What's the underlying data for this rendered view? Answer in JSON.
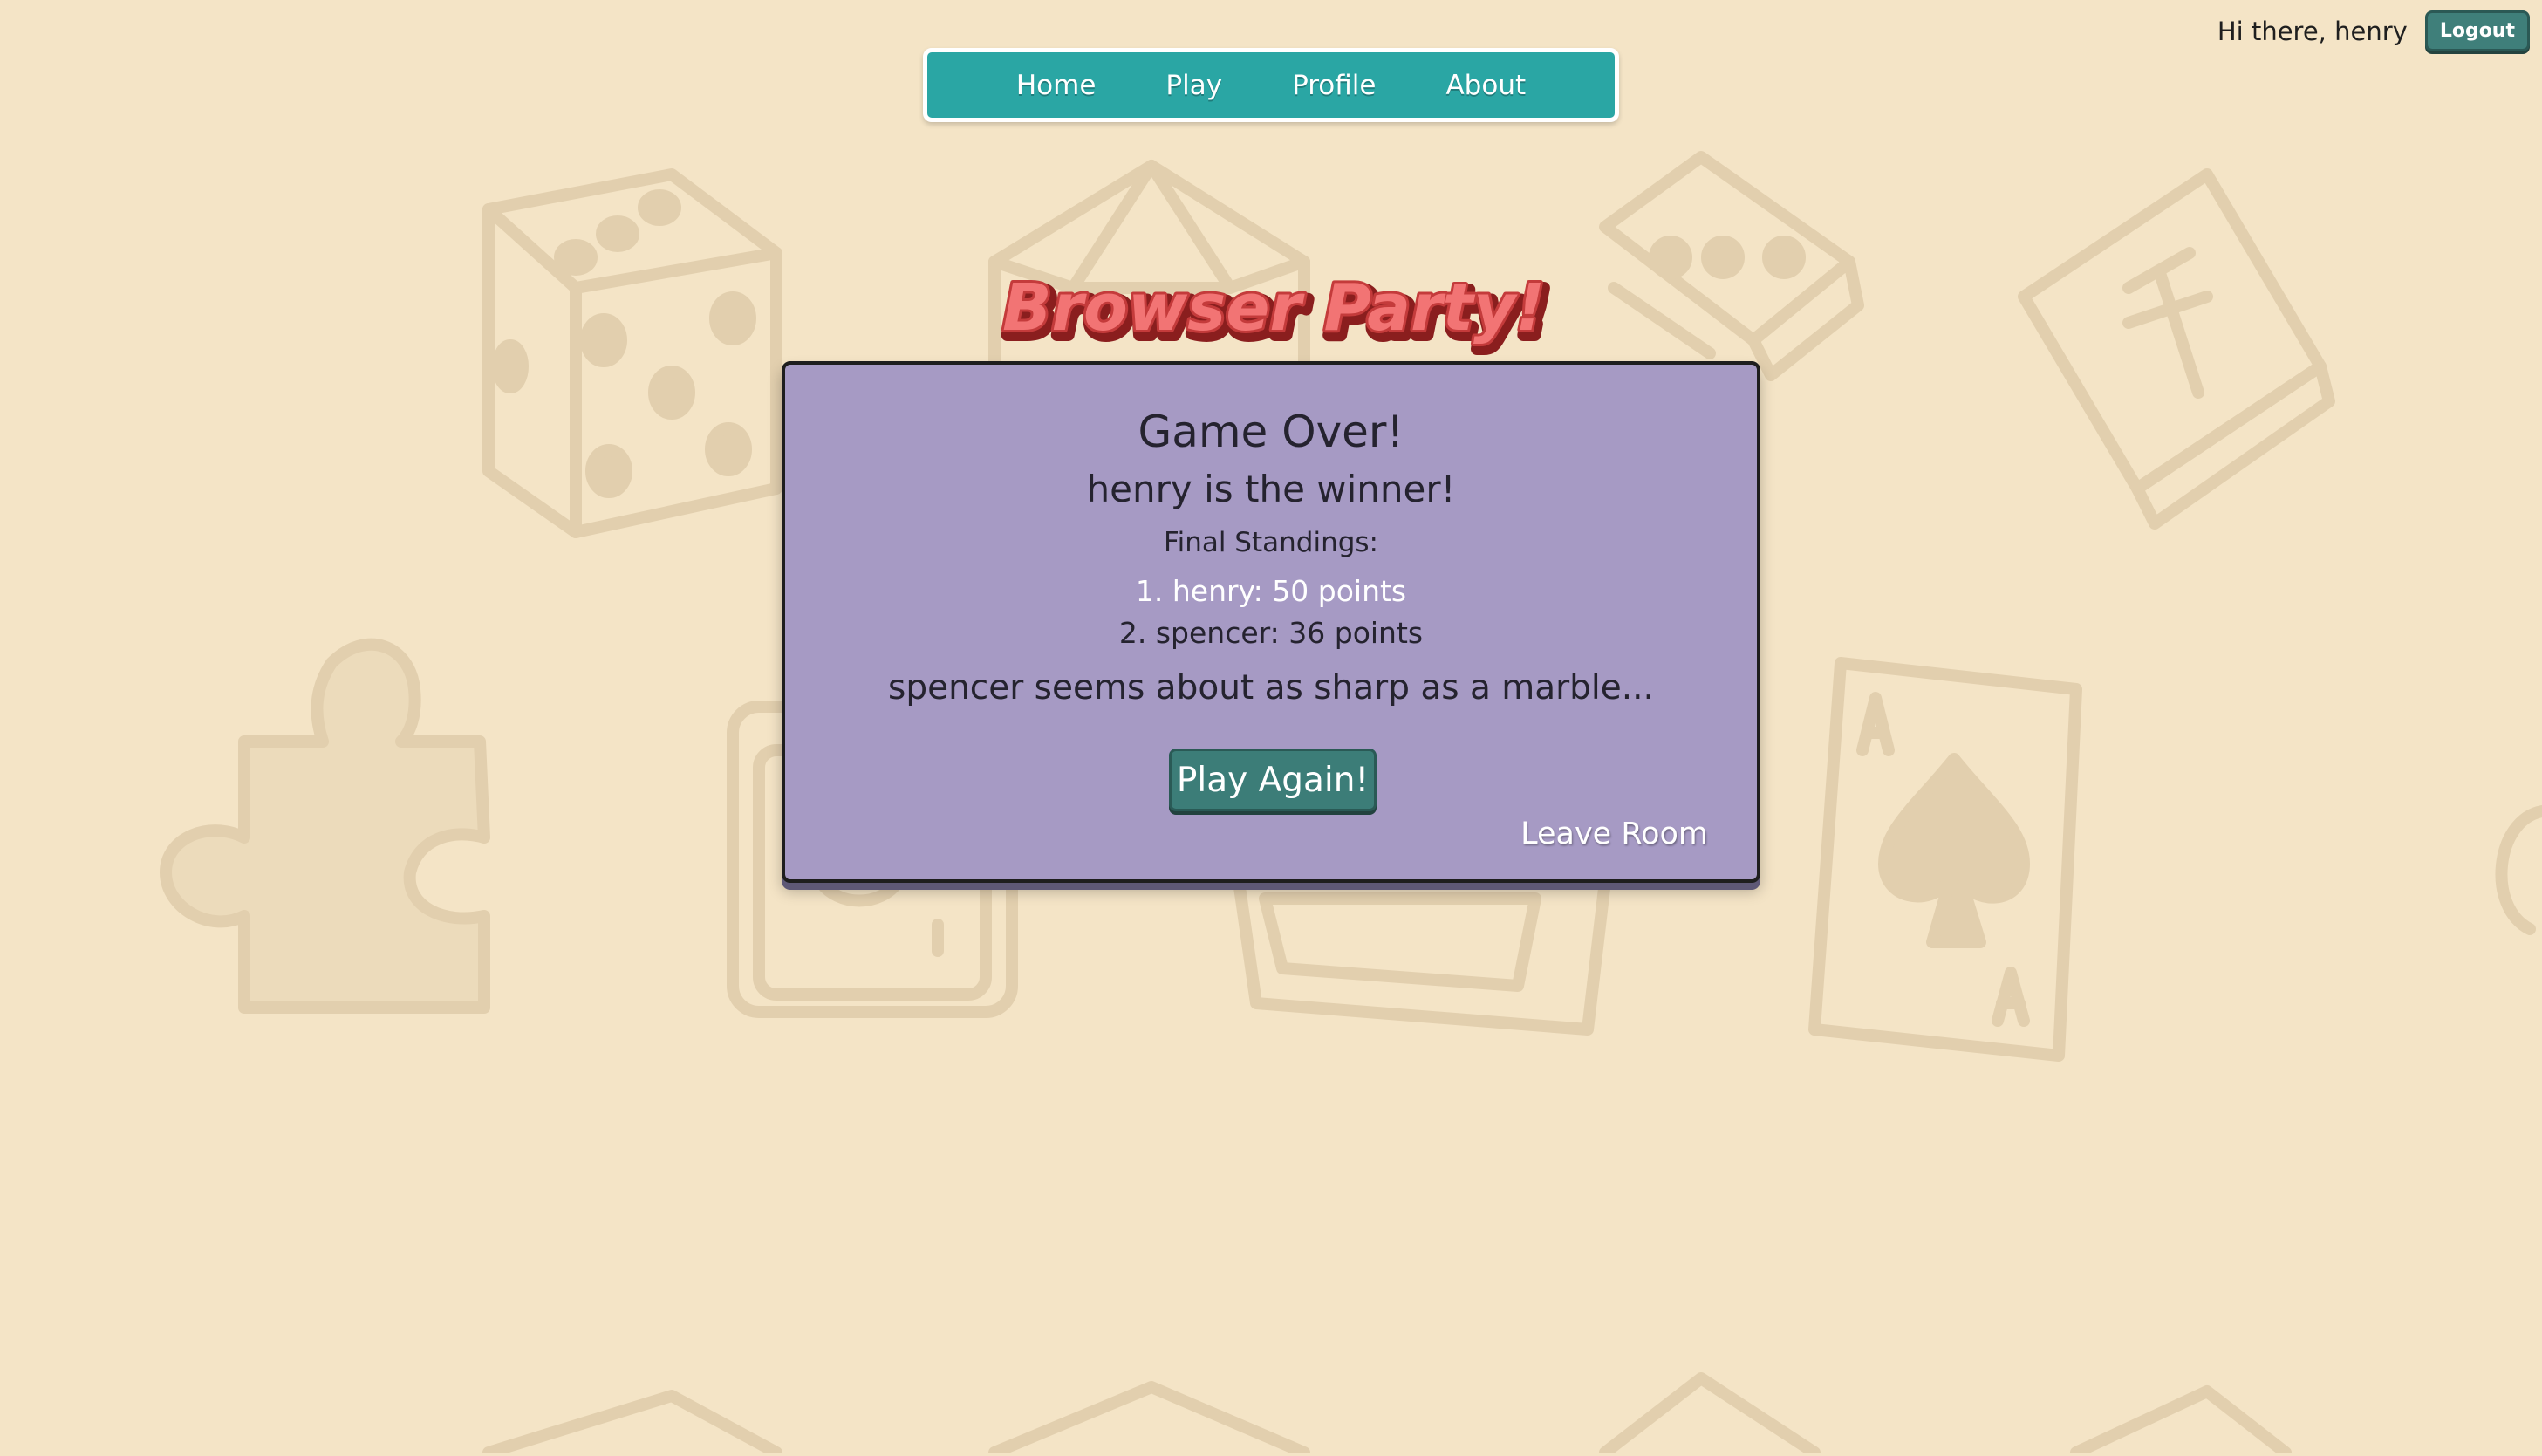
{
  "header": {
    "greeting": "Hi there, henry",
    "logout_label": "Logout"
  },
  "nav": {
    "items": [
      {
        "label": "Home"
      },
      {
        "label": "Play"
      },
      {
        "label": "Profile"
      },
      {
        "label": "About"
      }
    ]
  },
  "logo": {
    "text": "Browser Party!"
  },
  "game_over": {
    "title": "Game Over!",
    "winner_text": "henry is the winner!",
    "standings_heading": "Final Standings:",
    "standings": [
      {
        "text": "1. henry: 50 points"
      },
      {
        "text": "2. spencer: 36 points"
      }
    ],
    "taunt": "spencer seems about as sharp as a marble...",
    "play_again_label": "Play Again!",
    "leave_room_label": "Leave Room"
  },
  "colors": {
    "background": "#f4e4c6",
    "nav_teal": "#2aa6a4",
    "panel_purple": "#a69ac4",
    "button_teal": "#3c7d78",
    "logo_red": "#ee5d5d",
    "doodle_stroke": "#e2cfae"
  },
  "background_icons": [
    "dice-icon",
    "d20-icon",
    "domino-icon",
    "mahjong-tile-icon",
    "puzzle-piece-icon",
    "camera-icon",
    "card-stack-icon",
    "ace-of-spades-icon"
  ]
}
